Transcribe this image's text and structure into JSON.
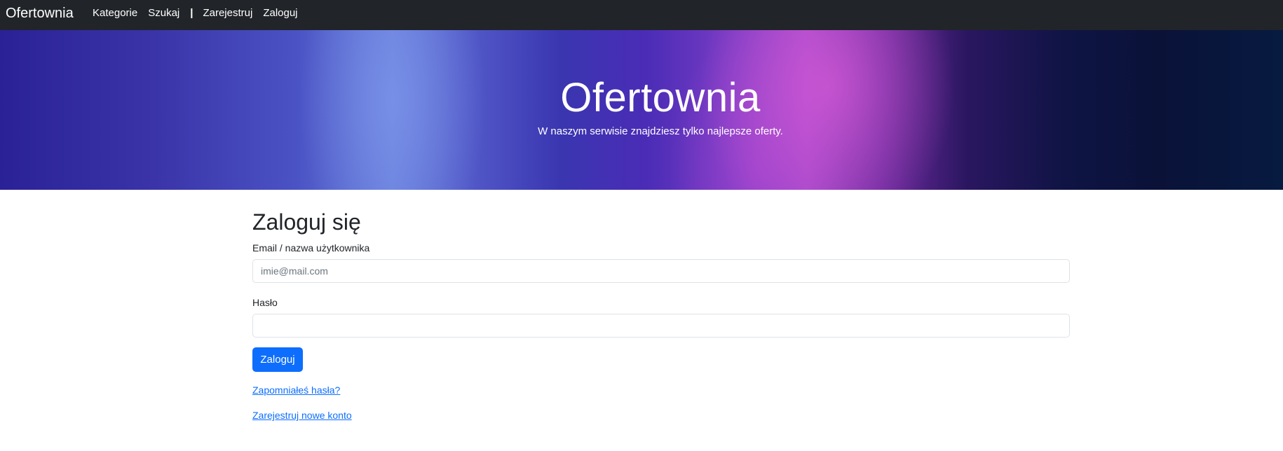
{
  "navbar": {
    "brand": "Ofertownia",
    "items": [
      {
        "label": "Kategorie"
      },
      {
        "label": "Szukaj"
      },
      {
        "label": "Zarejestruj"
      },
      {
        "label": "Zaloguj"
      }
    ],
    "separator": "|"
  },
  "hero": {
    "title": "Ofertownia",
    "subtitle": "W naszym serwisie znajdziesz tylko najlepsze oferty."
  },
  "login": {
    "heading": "Zaloguj się",
    "email_label": "Email / nazwa użytkownika",
    "email_placeholder": "imie@mail.com",
    "email_value": "",
    "password_label": "Hasło",
    "password_value": "",
    "submit_label": "Zaloguj",
    "forgot_link": "Zapomniałeś hasła?",
    "register_link": "Zarejestruj nowe konto"
  },
  "colors": {
    "navbar_bg": "#212529",
    "primary": "#0d6efd"
  }
}
